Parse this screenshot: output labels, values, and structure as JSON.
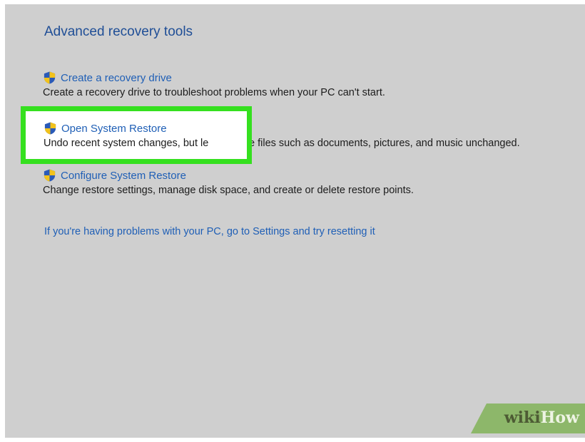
{
  "section_title": "Advanced recovery tools",
  "items": [
    {
      "link": "Create a recovery drive",
      "description": "Create a recovery drive to troubleshoot problems when your PC can't start."
    },
    {
      "link": "Open System Restore",
      "description_before_occlusion": "Undo recent system changes, but le",
      "description_after_occlusion": "e files such as documents, pictures, and music unchanged."
    },
    {
      "link": "Configure System Restore",
      "description": "Change restore settings, manage disk space, and create or delete restore points."
    }
  ],
  "settings_link": "If you're having problems with your PC, go to Settings and try resetting it",
  "watermark": {
    "wiki": "wiki",
    "how": "How"
  },
  "colors": {
    "background": "#cfcfcf",
    "title": "#1f4e96",
    "link": "#1f5fb6",
    "highlight_border": "#35e01f",
    "shield_blue": "#2a5ab8",
    "shield_yellow": "#f2c21b"
  },
  "icons": {
    "shield": "uac-shield-icon"
  }
}
